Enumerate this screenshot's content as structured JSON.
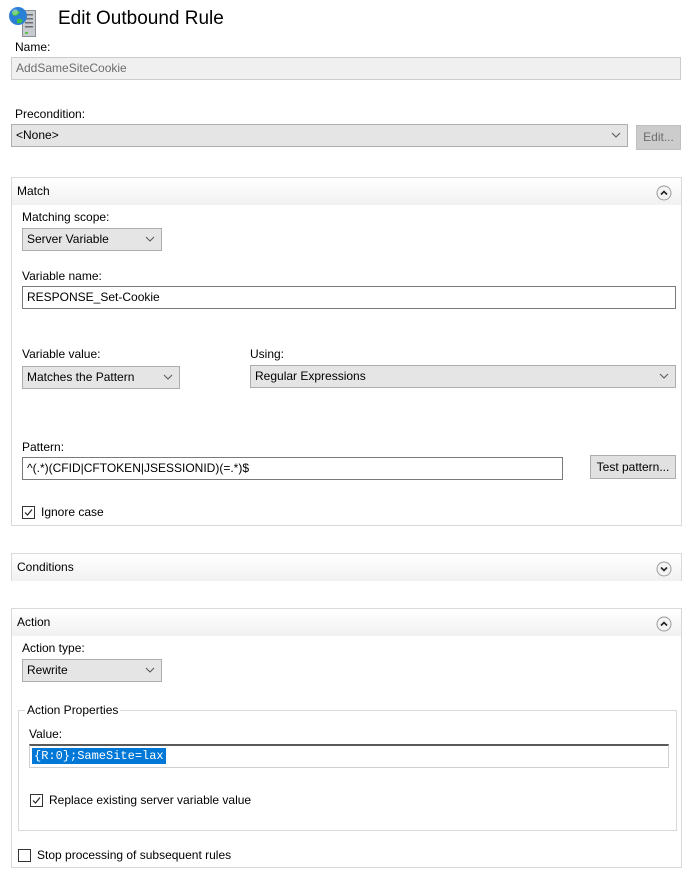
{
  "header": {
    "title": "Edit Outbound Rule",
    "icon": "server-globe-icon"
  },
  "name": {
    "label": "Name:",
    "value": "AddSameSiteCookie",
    "disabled": true
  },
  "precondition": {
    "label": "Precondition:",
    "selected": "<None>",
    "edit_button": "Edit...",
    "edit_disabled": true
  },
  "match": {
    "title": "Match",
    "expanded": true,
    "matching_scope": {
      "label": "Matching scope:",
      "selected": "Server Variable"
    },
    "variable_name": {
      "label": "Variable name:",
      "value": "RESPONSE_Set-Cookie"
    },
    "variable_value": {
      "label": "Variable value:",
      "selected": "Matches the Pattern"
    },
    "using": {
      "label": "Using:",
      "selected": "Regular Expressions"
    },
    "pattern": {
      "label": "Pattern:",
      "value": "^(.*)(CFID|CFTOKEN|JSESSIONID)(=.*)$"
    },
    "test_pattern_button": "Test pattern...",
    "ignore_case": {
      "label": "Ignore case",
      "checked": true
    }
  },
  "conditions": {
    "title": "Conditions",
    "expanded": false
  },
  "action": {
    "title": "Action",
    "expanded": true,
    "action_type": {
      "label": "Action type:",
      "selected": "Rewrite"
    },
    "properties": {
      "title": "Action Properties",
      "value_label": "Value:",
      "value": "{R:0};SameSite=lax",
      "value_selected": true,
      "replace_existing": {
        "label": "Replace existing server variable value",
        "checked": true
      }
    },
    "stop_processing": {
      "label": "Stop processing of subsequent rules",
      "checked": false
    }
  }
}
